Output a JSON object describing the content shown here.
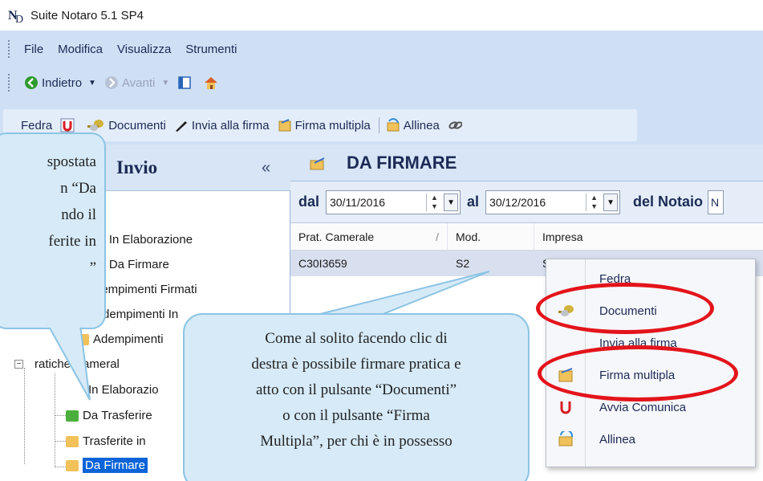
{
  "window": {
    "title": "Suite Notaro 5.1 SP4"
  },
  "menubar": {
    "items": [
      "File",
      "Modifica",
      "Visualizza",
      "Strumenti"
    ]
  },
  "nav_toolbar": {
    "back": "Indietro",
    "forward": "Avanti"
  },
  "main_toolbar": {
    "fedra": "Fedra",
    "documenti": "Documenti",
    "invia": "Invia alla firma",
    "firma_multipla": "Firma multipla",
    "allinea": "Allinea"
  },
  "left_pane": {
    "title": "Invio",
    "collapse": "«",
    "tree": [
      "le In Elaborazione",
      "le Da Firmare",
      "dempimenti Firmati",
      "Adempimenti In",
      "Adempimenti",
      "ratiche Cameral",
      "In Elaborazio",
      "Da Trasferire",
      "Trasferite in",
      "Da Firmare"
    ]
  },
  "right_pane": {
    "title": "DA FIRMARE",
    "filter": {
      "from_label": "dal",
      "from_date": "30/11/2016",
      "to_label": "al",
      "to_date": "30/12/2016",
      "notaio_label": "del Notaio",
      "notaio_value": "N"
    },
    "columns": [
      "Prat. Camerale",
      "Mod.",
      "Impresa"
    ],
    "sort_marker": "/",
    "rows": [
      {
        "prat": "C30I3659",
        "mod": "S2",
        "impresa": "S"
      }
    ]
  },
  "context_menu": {
    "items": [
      "Fedra",
      "Documenti",
      "Invia alla firma",
      "Firma multipla",
      "Avvia Comunica",
      "Allinea"
    ]
  },
  "callouts": {
    "left": [
      "spostata",
      "n “Da",
      "ndo il",
      "ferite in",
      "”"
    ],
    "bottom": [
      "Come al solito facendo clic di",
      "destra è possibile firmare pratica e",
      "atto con il pulsante “Documenti”",
      "o con il pulsante “Firma",
      "Multipla”, per chi è in possesso"
    ]
  },
  "colors": {
    "accent": "#0a64d8",
    "highlight_ring": "#e3141b",
    "callout_fill": "#d6eaf7"
  }
}
